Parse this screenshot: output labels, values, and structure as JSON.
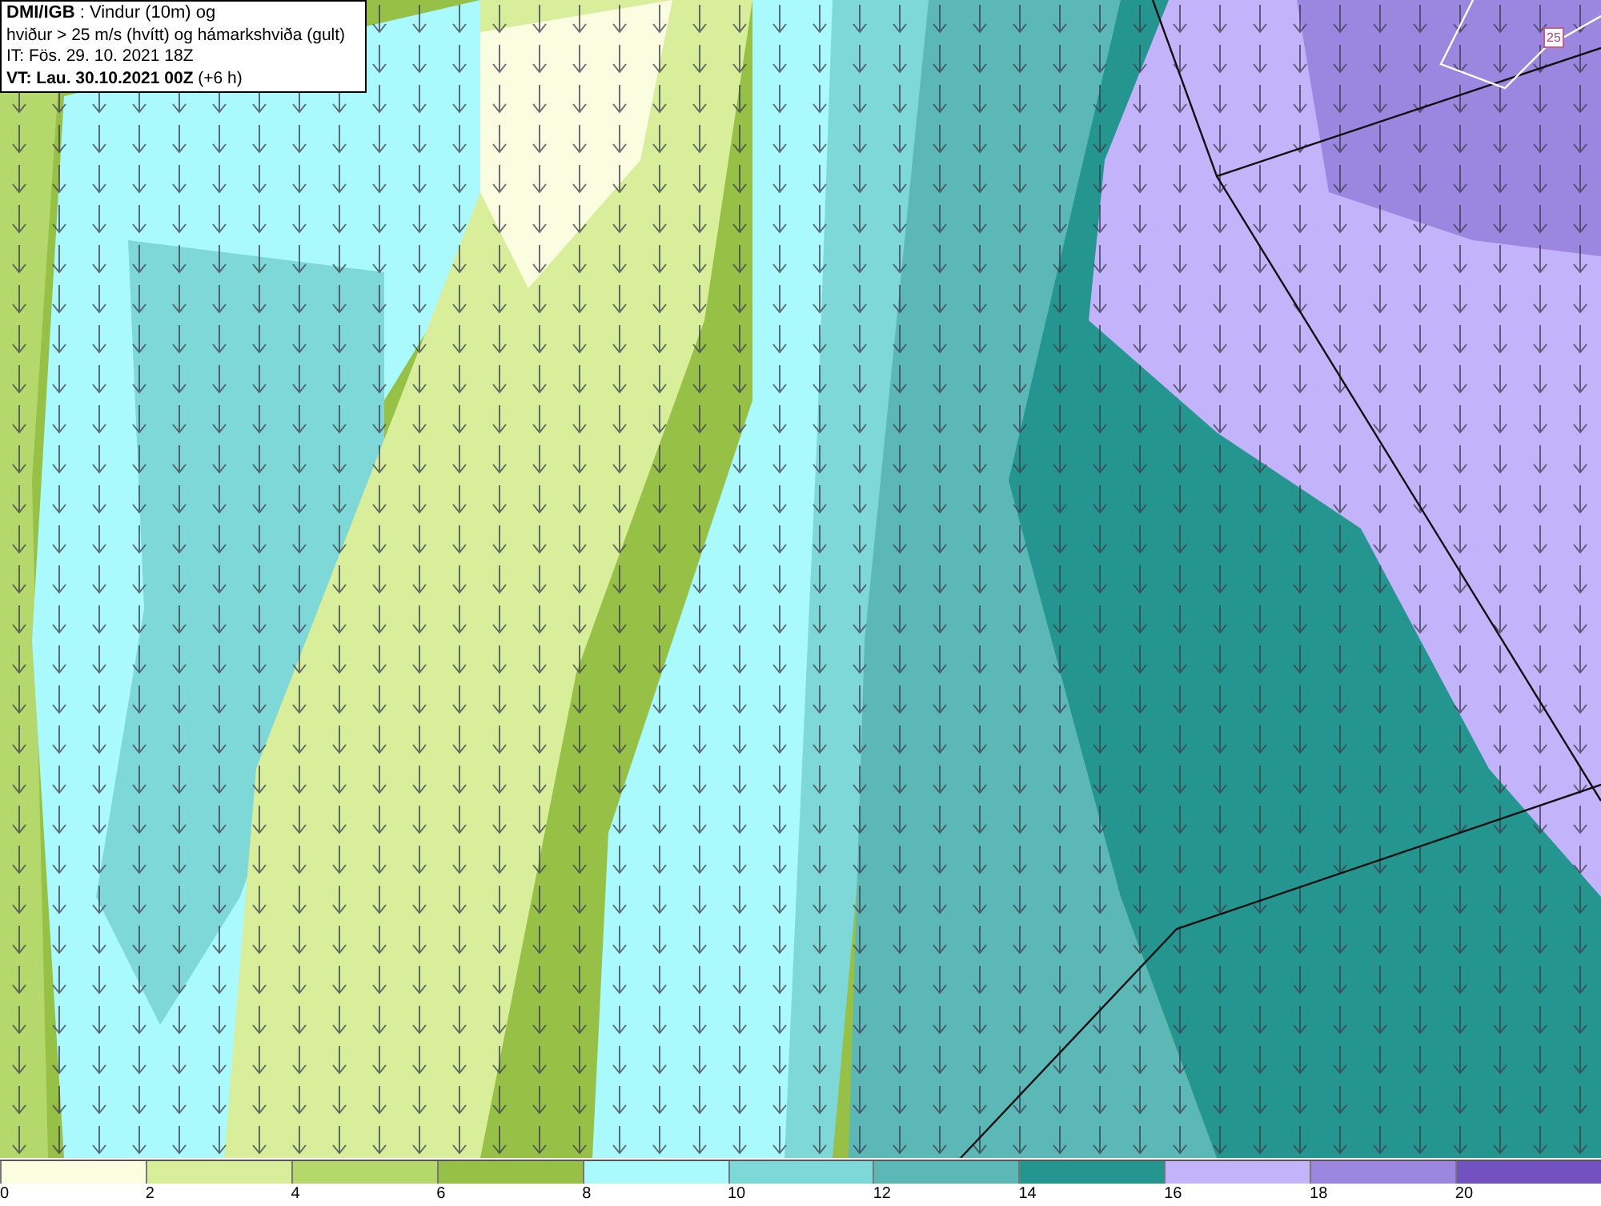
{
  "info_box": {
    "lines": [
      "**DMI/IGB** : Vindur (10m) og",
      "hviður > 25 m/s (hvítt) og hámarkshviða (gult)",
      "IT: Fös. 29. 10. 2021 18Z",
      "**VT: Lau. 30.10.2021 00Z** (+6 h)"
    ]
  },
  "map": {
    "label": "25"
  },
  "legend": {
    "bins": [
      {
        "color": "#fafde0"
      },
      {
        "color": "#d8ee9a"
      },
      {
        "color": "#b5d86c"
      },
      {
        "color": "#97c047"
      },
      {
        "color": "#aaf9fc"
      },
      {
        "color": "#7fd8d8"
      },
      {
        "color": "#5bb8b6"
      },
      {
        "color": "#259590"
      },
      {
        "color": "#c3b3fb"
      },
      {
        "color": "#9b86e0"
      },
      {
        "color": "#7252c0"
      }
    ],
    "ticks": [
      "0",
      "2",
      "4",
      "6",
      "8",
      "10",
      "12",
      "14",
      "16",
      "18",
      "20"
    ]
  }
}
